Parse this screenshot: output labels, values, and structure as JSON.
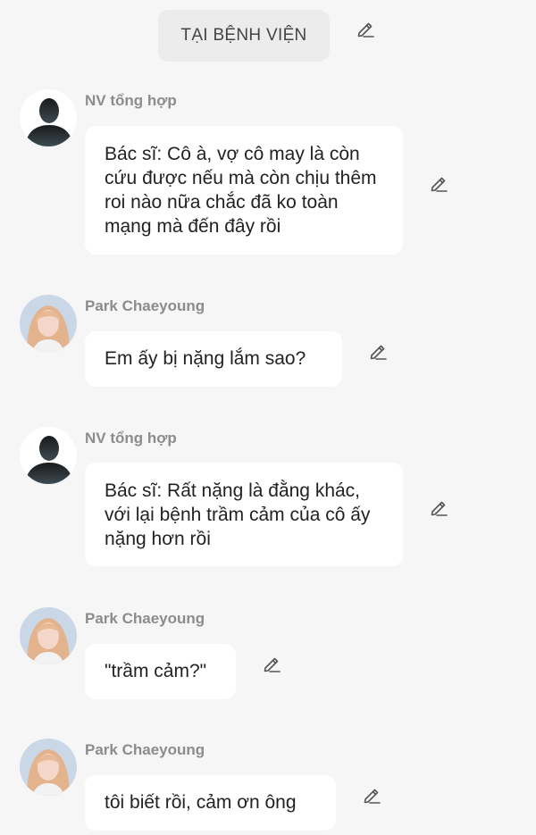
{
  "header": {
    "title": "TẠI BỆNH VIỆN"
  },
  "messages": [
    {
      "sender": "NV tổng hợp",
      "avatar": "silhouette-avatar",
      "text": "Bác sĩ: Cô à, vợ cô may là còn cứu được nếu mà còn chịu thêm roi nào nữa chắc đã ko toàn mạng mà đến đây rồi"
    },
    {
      "sender": "Park Chaeyoung",
      "avatar": "woman-portrait-avatar",
      "text": "Em ấy bị nặng lắm sao?"
    },
    {
      "sender": "NV tổng hợp",
      "avatar": "silhouette-avatar",
      "text": "Bác sĩ: Rất nặng là đằng khác, với lại bệnh trầm cảm của cô ấy nặng hơn rồi"
    },
    {
      "sender": "Park Chaeyoung",
      "avatar": "woman-portrait-avatar",
      "text": "\"trầm cảm?\""
    },
    {
      "sender": "Park Chaeyoung",
      "avatar": "woman-portrait-avatar",
      "text": "tôi biết rồi, cảm ơn ông"
    }
  ],
  "icons": {
    "edit": "pencil-icon"
  },
  "colors": {
    "background": "#f6f6f6",
    "bubble": "#ffffff",
    "header_pill": "#ececec",
    "sender_text": "#8c8c8c"
  }
}
